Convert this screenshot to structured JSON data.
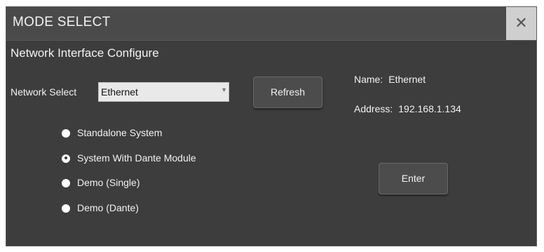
{
  "window": {
    "title": "MODE SELECT",
    "close_glyph": "✕"
  },
  "main": {
    "subtitle": "Network Interface Configure",
    "network_select_label": "Network Select",
    "network_select_value": "Ethernet",
    "network_select_arrow": "▼",
    "refresh_label": "Refresh",
    "enter_label": "Enter",
    "info": {
      "name_label": "Name:",
      "name_value": "Ethernet",
      "address_label": "Address:",
      "address_value": "192.168.1.134"
    },
    "modes": [
      {
        "label": "Standalone System",
        "checked": false
      },
      {
        "label": "System With Dante Module",
        "checked": true
      },
      {
        "label": "Demo (Single)",
        "checked": false
      },
      {
        "label": "Demo (Dante)",
        "checked": false
      }
    ]
  }
}
